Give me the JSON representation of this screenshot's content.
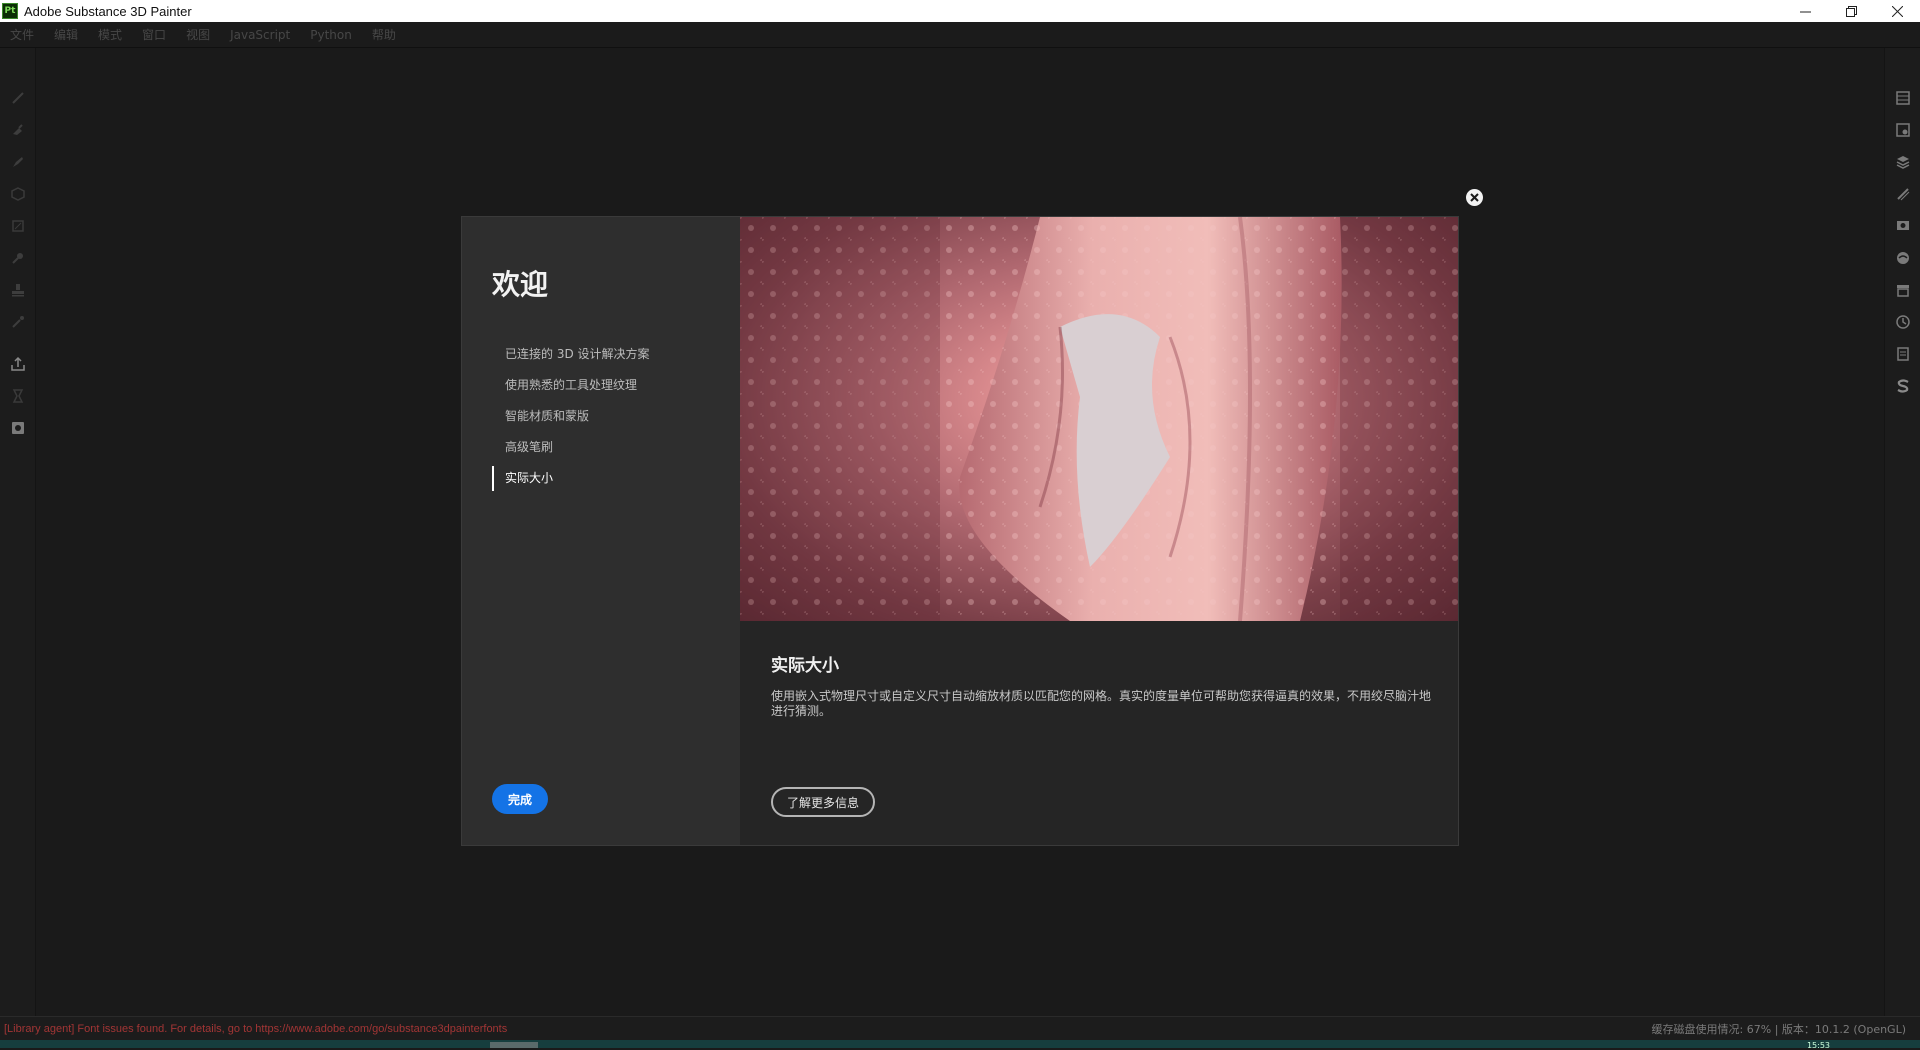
{
  "window": {
    "logo_text": "Pt",
    "title": "Adobe Substance 3D Painter",
    "controls": [
      "minimize-icon",
      "restore-icon",
      "close-icon"
    ]
  },
  "menu": {
    "items": [
      "文件",
      "编辑",
      "模式",
      "窗口",
      "视图",
      "JavaScript",
      "Python",
      "帮助"
    ]
  },
  "left_toolbar": {
    "icons": [
      "paint-brush-icon",
      "eraser-icon",
      "projection-icon",
      "geometry-mask-icon",
      "polygon-fill-icon",
      "smudge-icon",
      "clone-stamp-icon",
      "color-picker-icon",
      "export-icon",
      "bake-icon",
      "screenshot-icon"
    ]
  },
  "right_toolbar": {
    "icons": [
      "texture-set-list-icon",
      "texture-set-settings-icon",
      "layers-icon",
      "properties-icon",
      "display-settings-icon",
      "environment-icon",
      "shelf-icon",
      "history-icon",
      "log-icon",
      "substance-icon"
    ]
  },
  "dialog": {
    "heading": "欢迎",
    "nav": [
      {
        "label": "已连接的 3D 设计解决方案",
        "active": false
      },
      {
        "label": "使用熟悉的工具处理纹理",
        "active": false
      },
      {
        "label": "智能材质和蒙版",
        "active": false
      },
      {
        "label": "高级笔刷",
        "active": false
      },
      {
        "label": "实际大小",
        "active": true
      }
    ],
    "done_label": "完成",
    "content_title": "实际大小",
    "content_desc": "使用嵌入式物理尺寸或自定义尺寸自动缩放材质以匹配您的网格。真实的度量单位可帮助您获得逼真的效果，不用绞尽脑汁地进行猜测。",
    "learn_more_label": "了解更多信息",
    "image_icon": "pink-fabric-drape-image"
  },
  "status": {
    "left_message": "[Library agent] Font issues found. For details, go to https://www.adobe.com/go/substance3dpainterfonts",
    "right_info": "缓存磁盘使用情况:     67% | 版本：10.1.2 (OpenGL)"
  },
  "taskbar": {
    "time": "15:53"
  },
  "colors": {
    "accent": "#1473e6",
    "error_text": "#a23535",
    "dialog_bg": "#252525",
    "dialog_side_bg": "#2e2e2e"
  }
}
